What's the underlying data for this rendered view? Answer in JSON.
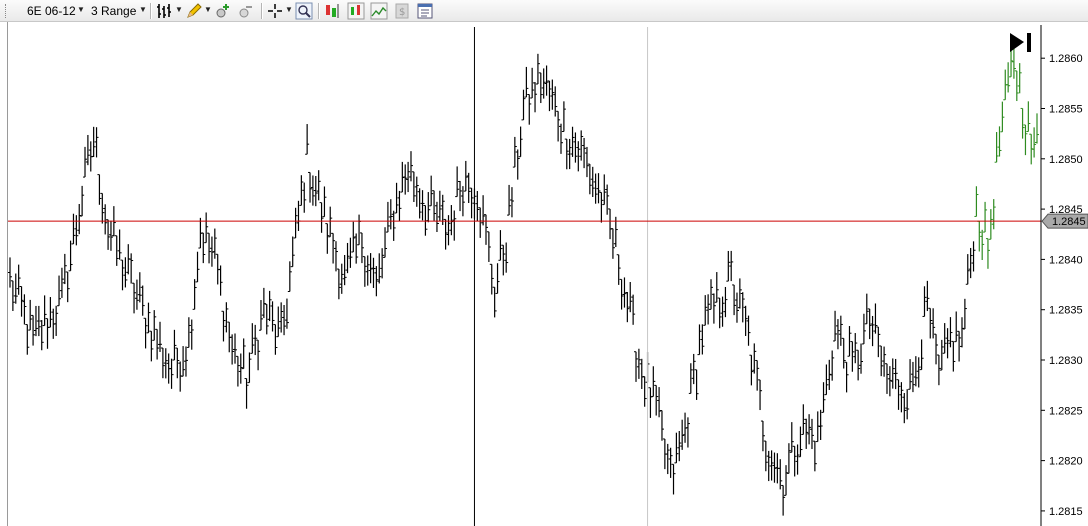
{
  "toolbar": {
    "instrument": "6E 06-12",
    "bar_type": "3 Range",
    "icons": [
      "bar-style-icon",
      "pencil-icon",
      "zoom-in-icon",
      "zoom-out-icon",
      "crosshair-icon",
      "magnifier-icon",
      "strategies-icon",
      "indicators-icon",
      "chart-style-icon",
      "data-box-icon",
      "properties-icon"
    ]
  },
  "colors": {
    "bar": "#000000",
    "bar_up_recent": "#2e8b20",
    "price_line": "#cc0000",
    "price_tag_bg": "#a9a9a9",
    "vertical_marker": "#000000",
    "vertical_marker_light": "#c8c8c8"
  },
  "chart_data": {
    "type": "ohlc-range",
    "ylim": [
      1.28135,
      1.28633
    ],
    "y_ticks": [
      "1.2815",
      "1.2820",
      "1.2825",
      "1.2830",
      "1.2835",
      "1.2840",
      "1.2845",
      "1.2850",
      "1.2855",
      "1.2860"
    ],
    "current_price": 1.28438,
    "current_price_label": "1.2845",
    "bar_range": 0.0003,
    "bars_count": 357,
    "green_from_index": 335,
    "vertical_markers_at_index": [
      161,
      221
    ],
    "path_waypoints": [
      [
        0,
        1.2838
      ],
      [
        8,
        1.2832
      ],
      [
        18,
        1.2836
      ],
      [
        24,
        1.2845
      ],
      [
        29,
        1.2852
      ],
      [
        34,
        1.2843
      ],
      [
        46,
        1.2835
      ],
      [
        56,
        1.2829
      ],
      [
        62,
        1.2832
      ],
      [
        66,
        1.2843
      ],
      [
        71,
        1.284
      ],
      [
        77,
        1.2831
      ],
      [
        82,
        1.2828
      ],
      [
        88,
        1.2835
      ],
      [
        94,
        1.2832
      ],
      [
        103,
        1.285
      ],
      [
        108,
        1.2845
      ],
      [
        116,
        1.2838
      ],
      [
        122,
        1.2842
      ],
      [
        127,
        1.2837
      ],
      [
        133,
        1.2845
      ],
      [
        138,
        1.2849
      ],
      [
        145,
        1.2845
      ],
      [
        152,
        1.2843
      ],
      [
        157,
        1.2848
      ],
      [
        162,
        1.2847
      ],
      [
        168,
        1.2837
      ],
      [
        172,
        1.2842
      ],
      [
        178,
        1.2855
      ],
      [
        184,
        1.2858
      ],
      [
        192,
        1.2853
      ],
      [
        199,
        1.285
      ],
      [
        205,
        1.2846
      ],
      [
        211,
        1.284
      ],
      [
        218,
        1.283
      ],
      [
        224,
        1.2825
      ],
      [
        229,
        1.2818
      ],
      [
        234,
        1.2823
      ],
      [
        240,
        1.2833
      ],
      [
        246,
        1.2836
      ],
      [
        250,
        1.2838
      ],
      [
        256,
        1.2832
      ],
      [
        262,
        1.2822
      ],
      [
        268,
        1.2818
      ],
      [
        274,
        1.2823
      ],
      [
        280,
        1.2822
      ],
      [
        286,
        1.2833
      ],
      [
        292,
        1.2829
      ],
      [
        298,
        1.2834
      ],
      [
        304,
        1.2828
      ],
      [
        312,
        1.2827
      ],
      [
        318,
        1.2835
      ],
      [
        322,
        1.2828
      ],
      [
        326,
        1.2832
      ],
      [
        330,
        1.2832
      ],
      [
        335,
        1.2845
      ],
      [
        339,
        1.2841
      ],
      [
        343,
        1.2852
      ],
      [
        348,
        1.286
      ],
      [
        352,
        1.2854
      ],
      [
        355,
        1.285
      ],
      [
        358,
        1.2857
      ],
      [
        362,
        1.286
      ]
    ]
  }
}
